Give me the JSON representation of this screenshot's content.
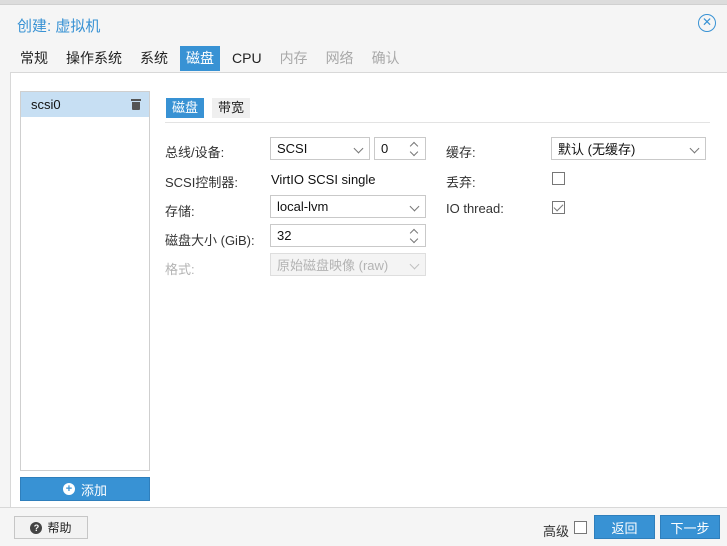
{
  "window": {
    "title": "创建: 虚拟机"
  },
  "wizard_tabs": [
    {
      "label": "常规",
      "state": "normal"
    },
    {
      "label": "操作系统",
      "state": "normal"
    },
    {
      "label": "系统",
      "state": "normal"
    },
    {
      "label": "磁盘",
      "state": "active"
    },
    {
      "label": "CPU",
      "state": "normal"
    },
    {
      "label": "内存",
      "state": "disabled"
    },
    {
      "label": "网络",
      "state": "disabled"
    },
    {
      "label": "确认",
      "state": "disabled"
    }
  ],
  "disk_list": {
    "items": [
      {
        "label": "scsi0",
        "selected": true
      }
    ],
    "add_label": "添加"
  },
  "subtabs": [
    {
      "label": "磁盘",
      "active": true
    },
    {
      "label": "带宽",
      "active": false
    }
  ],
  "form": {
    "bus_label": "总线/设备:",
    "bus_value": "SCSI",
    "device_value": "0",
    "scsi_ctrl_label": "SCSI控制器:",
    "scsi_ctrl_value": "VirtIO SCSI single",
    "storage_label": "存储:",
    "storage_value": "local-lvm",
    "size_label": "磁盘大小 (GiB):",
    "size_value": "32",
    "format_label": "格式:",
    "format_value": "原始磁盘映像 (raw)",
    "cache_label": "缓存:",
    "cache_value": "默认 (无缓存)",
    "discard_label": "丢弃:",
    "discard_checked": false,
    "iothread_label": "IO thread:",
    "iothread_checked": true
  },
  "footer": {
    "help_label": "帮助",
    "advanced_label": "高级",
    "advanced_checked": false,
    "back_label": "返回",
    "next_label": "下一步"
  },
  "colors": {
    "accent": "#3892d4",
    "selected_row": "#c7dff3",
    "disabled_text": "#a9a9a9"
  }
}
